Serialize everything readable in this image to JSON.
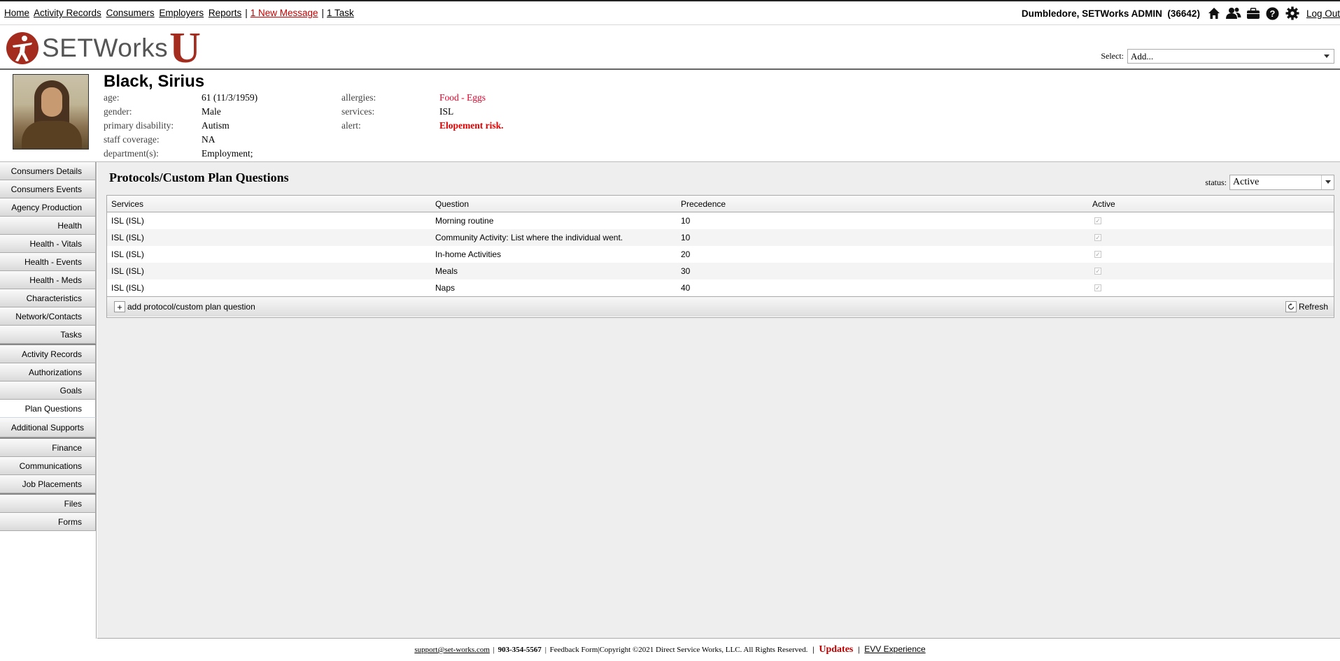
{
  "topnav": {
    "links": [
      "Home",
      "Activity Records",
      "Consumers",
      "Employers",
      "Reports"
    ],
    "messages": "1 New Message",
    "tasks": "1 Task",
    "separator": "|"
  },
  "user": {
    "name": "Dumbledore, SETWorks ADMIN",
    "id": "(36642)",
    "logout": "Log Out",
    "icons": [
      "home-icon",
      "users-icon",
      "briefcase-icon",
      "help-icon",
      "gear-icon"
    ]
  },
  "logo": {
    "brand": "SETWorks",
    "letter": "U",
    "color": "#a32c1f"
  },
  "select": {
    "label": "Select:",
    "value": "Add..."
  },
  "consumer": {
    "name": "Black, Sirius",
    "fields_left": [
      {
        "label": "age:",
        "value": "61 (11/3/1959)"
      },
      {
        "label": "gender:",
        "value": "Male"
      },
      {
        "label": "primary disability:",
        "value": "Autism"
      },
      {
        "label": "staff coverage:",
        "value": "NA"
      },
      {
        "label": "department(s):",
        "value": "Employment;"
      }
    ],
    "fields_right": [
      {
        "label": "allergies:",
        "value": "Food - Eggs"
      },
      {
        "label": "services:",
        "value": "ISL"
      },
      {
        "label": "alert:",
        "value": "Elopement risk."
      }
    ]
  },
  "sidebar": {
    "groups": [
      [
        "Consumers Details",
        "Consumers Events",
        "Agency Production",
        "Health",
        "Health - Vitals",
        "Health - Events",
        "Health - Meds",
        "Characteristics",
        "Network/Contacts",
        "Tasks"
      ],
      [
        "Activity Records",
        "Authorizations",
        "Goals",
        "Plan Questions",
        "Additional Supports"
      ],
      [
        "Finance",
        "Communications",
        "Job Placements"
      ],
      [
        "Files",
        "Forms"
      ]
    ],
    "active": "Plan Questions"
  },
  "main": {
    "title": "Protocols/Custom Plan Questions",
    "status_label": "status:",
    "status_value": "Active",
    "columns": [
      "Services",
      "Question",
      "Precedence",
      "Active"
    ],
    "rows": [
      {
        "service": "ISL (ISL)",
        "question": "Morning routine",
        "precedence": "10",
        "active": true
      },
      {
        "service": "ISL (ISL)",
        "question": "Community Activity: List where the individual went.",
        "precedence": "10",
        "active": true
      },
      {
        "service": "ISL (ISL)",
        "question": "In-home Activities",
        "precedence": "20",
        "active": true
      },
      {
        "service": "ISL (ISL)",
        "question": "Meals",
        "precedence": "30",
        "active": true
      },
      {
        "service": "ISL (ISL)",
        "question": "Naps",
        "precedence": "40",
        "active": true
      }
    ],
    "add_label": "add protocol/custom plan question",
    "refresh_label": "Refresh"
  },
  "footer": {
    "email": "support@set-works.com",
    "phone": "903-354-5567",
    "feedback": "Feedback Form",
    "copyright": "Copyright ©2021 Direct Service Works, LLC. All Rights Reserved.",
    "updates": "Updates",
    "evv": "EVV Experience"
  }
}
